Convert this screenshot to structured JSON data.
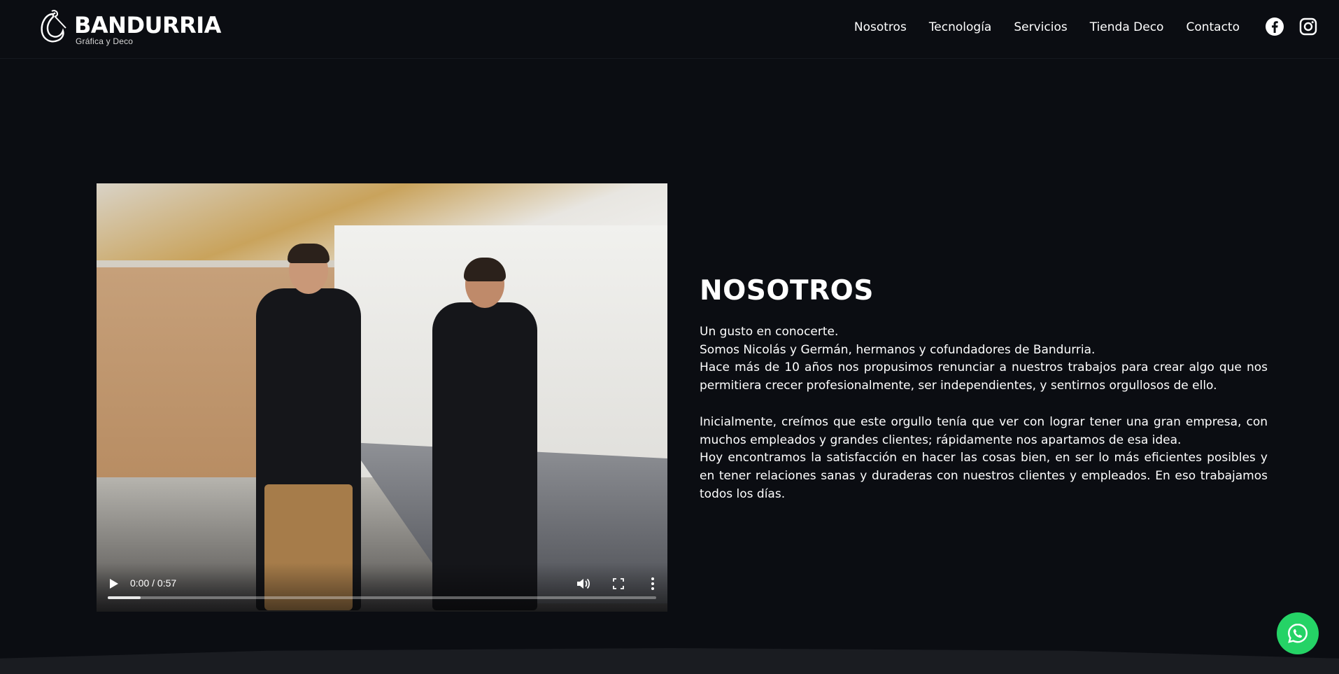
{
  "brand": {
    "name": "BANDURRIA",
    "tagline": "Gráfica y Deco"
  },
  "nav": {
    "items": [
      {
        "label": "Nosotros"
      },
      {
        "label": "Tecnología"
      },
      {
        "label": "Servicios"
      },
      {
        "label": "Tienda Deco"
      },
      {
        "label": "Contacto"
      }
    ],
    "social": [
      "facebook-icon",
      "instagram-icon"
    ]
  },
  "video": {
    "time": "0:00 / 0:57",
    "progress_fraction": 0.06
  },
  "about": {
    "title": "NOSOTROS",
    "p1": "Un gusto en conocerte.",
    "p2": "Somos Nicolás y Germán, hermanos y cofundadores de Bandurria.",
    "p3": "Hace más de 10 años nos propusimos renunciar a nuestros trabajos para crear algo que nos permitiera crecer profesionalmente, ser independientes, y sentirnos orgullosos de ello.",
    "p4": "Inicialmente, creímos que este orgullo tenía que ver con lograr tener una gran empresa, con muchos empleados y grandes clientes; rápidamente nos apartamos de esa idea.",
    "p5": "Hoy encontramos la satisfacción en hacer las cosas bien, en ser lo más eficientes posibles y en tener relaciones sanas y duraderas con nuestros clientes y empleados. En eso trabajamos todos los días."
  },
  "colors": {
    "background": "#0b0d12",
    "whatsapp": "#25d366"
  }
}
